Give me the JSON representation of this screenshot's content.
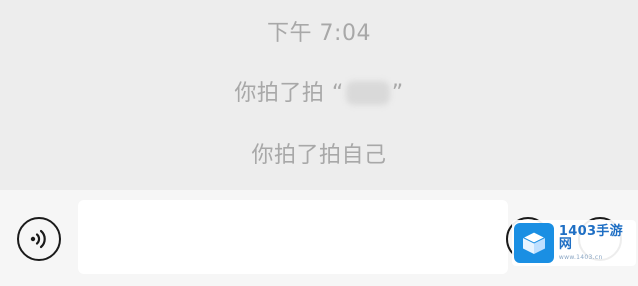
{
  "chat": {
    "timestamp": "下午 7:04",
    "messages": [
      {
        "prefix": "你拍了拍 “",
        "suffix": "”"
      },
      {
        "text": "你拍了拍自己"
      }
    ]
  },
  "input_bar": {
    "voice_icon": "voice-waves-icon",
    "emoji_icon": "emoji-icon",
    "plus_icon": "plus-icon"
  },
  "watermark": {
    "title": "1403手游网",
    "subtitle": "www.1403.cn",
    "color": "#1a8fe3"
  }
}
